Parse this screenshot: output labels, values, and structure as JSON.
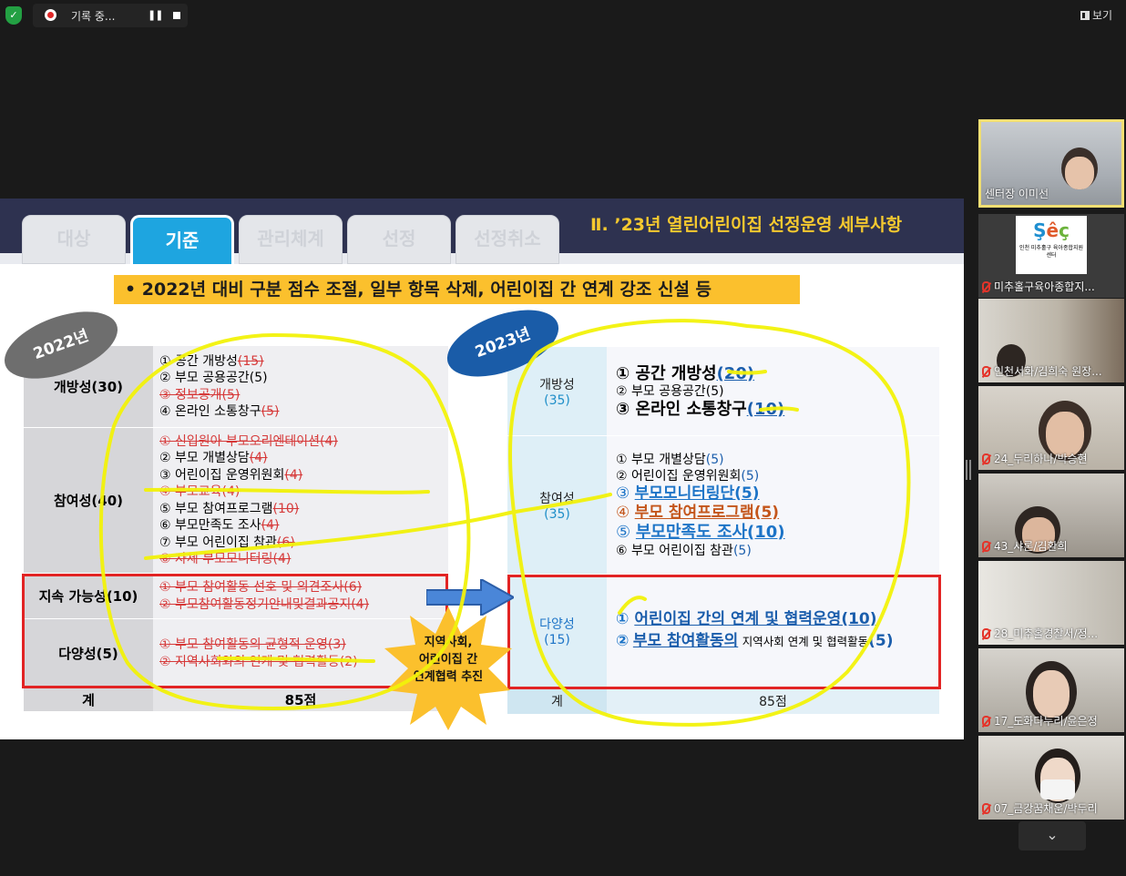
{
  "topbar": {
    "shield_icon": "shield-check-icon",
    "recording_text": "기록 중...",
    "pause_symbol": "❚❚",
    "view_label": "보기"
  },
  "slide": {
    "tabs": [
      "대상",
      "기준",
      "관리체계",
      "선정",
      "선정취소"
    ],
    "active_tab": "기준",
    "section_title": "Ⅱ. ’23년 열린어린이집 선정운영 세부사항",
    "banner": "•  2022년 대비 구분 점수 조절, 일부 항목 삭제, 어린이집 간 연계 강조 신설 등",
    "label_2022": "2022년",
    "label_2023": "2023년",
    "table_2022": {
      "rows": [
        {
          "category": "개방성(30)",
          "items": [
            {
              "text": "① 공간 개방성",
              "pts": "(15)",
              "deleted": false,
              "pts_deleted": true
            },
            {
              "text": "② 부모 공용공간(5)",
              "pts": "",
              "deleted": false
            },
            {
              "text": "③ 정보공개(5)",
              "pts": "",
              "deleted": true
            },
            {
              "text": "④ 온라인 소통창구",
              "pts": "(5)",
              "deleted": false,
              "pts_deleted": true
            }
          ]
        },
        {
          "category": "참여성(40)",
          "items": [
            {
              "text": "① 신입원아 부모오리엔테이션(4)",
              "pts": "",
              "deleted": true
            },
            {
              "text": "② 부모 개별상담",
              "pts": "(4)",
              "deleted": false,
              "pts_deleted": true
            },
            {
              "text": "③ 어린이집 운영위원회",
              "pts": "(4)",
              "deleted": false,
              "pts_deleted": true
            },
            {
              "text": "④ 부모교육(4)",
              "pts": "",
              "deleted": true
            },
            {
              "text": "⑤ 부모 참여프로그램",
              "pts": "(10)",
              "deleted": false,
              "pts_deleted": true
            },
            {
              "text": "⑥ 부모만족도 조사",
              "pts": "(4)",
              "deleted": false,
              "pts_deleted": true
            },
            {
              "text": "⑦ 부모 어린이집 참관",
              "pts": "(6)",
              "deleted": false,
              "pts_deleted": true
            },
            {
              "text": "⑧ 자체 부모모니터링(4)",
              "pts": "",
              "deleted": true
            }
          ]
        },
        {
          "category": "지속 가능성(10)",
          "items": [
            {
              "text": "① 부모 참여활동 선호 및 의견조사(6)",
              "pts": "",
              "deleted": true
            },
            {
              "text": "② 부모참여활동정기안내및결과공지(4)",
              "pts": "",
              "deleted": true
            }
          ]
        },
        {
          "category": "다양성(5)",
          "items": [
            {
              "text": "① 부모 참여활동의 균형적 운영(3)",
              "pts": "",
              "deleted": true
            },
            {
              "text": "② 지역사회와의 연계 및 협력활동(2)",
              "pts": "",
              "deleted": true
            }
          ]
        }
      ],
      "total_label": "계",
      "total_value": "85점"
    },
    "table_2023": {
      "rows": [
        {
          "category": "개방성",
          "points": "(35)"
        },
        {
          "category": "참여성",
          "points": "(35)"
        },
        {
          "category": "다양성",
          "points": "(15)"
        }
      ],
      "open_items": [
        "①  공간 개방성",
        "(20)",
        "②  부모 공용공간(5)",
        "③  온라인 소통창구",
        "(10)"
      ],
      "part_items": [
        "①  부모 개별상담",
        "(5)",
        "②  어린이집 운영위원회",
        "(5)",
        "③",
        "부모모니터링단(5)",
        "④",
        "부모 참여프로그램(5)",
        "⑤",
        "부모만족도 조사(10)",
        "⑥  부모 어린이집 참관",
        "(5)"
      ],
      "div_items": [
        "①",
        "어린이집 간의 연계 및 협력운영(10)",
        "②",
        "부모 참여활동의",
        "지역사회 연계 및 협력활동",
        "(5)"
      ],
      "total_label": "계",
      "total_value": "85점"
    },
    "starburst_text": [
      "지역사회,",
      "어린이집 간",
      "연계협력 추진"
    ]
  },
  "participants": [
    {
      "name": "센터장 이미선",
      "muted": false,
      "active": true
    },
    {
      "name": "미추홀구육아종합지...",
      "muted": true,
      "logo_text": "인천 미추홀구 육아종합지원센터"
    },
    {
      "name": "인천서화/김희숙 원장...",
      "muted": true
    },
    {
      "name": "24_두리하나/박승현",
      "muted": true
    },
    {
      "name": "43_샤론/김환희",
      "muted": true
    },
    {
      "name": "28_미추홀경찰서/정...",
      "muted": true
    },
    {
      "name": "17_도화다누리/윤은정",
      "muted": true
    },
    {
      "name": "07_금강꿈채운/박두리",
      "muted": true
    }
  ],
  "colors": {
    "highlight": "#f2f20a",
    "tab_active": "#1ea5e0",
    "nav_bg": "#2e3250",
    "banner": "#fbc02d",
    "delete_red": "#d63a3a",
    "box_red": "#e22424",
    "zoom_green": "#23a043"
  }
}
